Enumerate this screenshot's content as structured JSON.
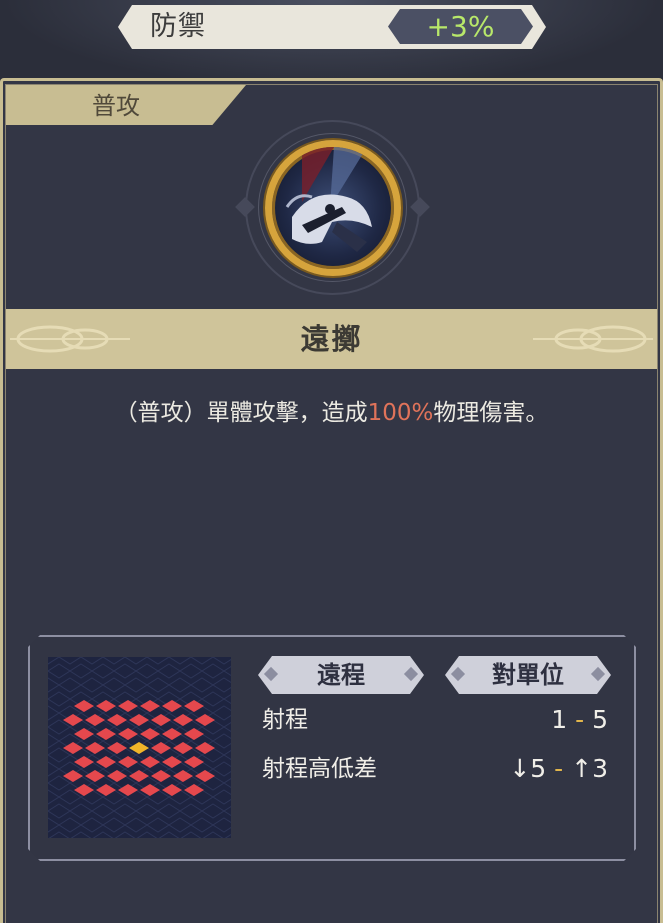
{
  "stat": {
    "label": "防禦",
    "value": "+3%"
  },
  "tab": {
    "label": "普攻"
  },
  "skill": {
    "icon": "thrown-axe-icon",
    "name": "遠擲",
    "description_prefix": "（普攻）單體攻擊，造成",
    "description_highlight": "100%",
    "description_suffix": "物理傷害。"
  },
  "range": {
    "tags": [
      "遠程",
      "對單位"
    ],
    "rows": [
      {
        "label": "射程",
        "min": "1",
        "sep": "-",
        "max": "5"
      },
      {
        "label": "射程高低差",
        "min": "↓5",
        "sep": "-",
        "max": "↑3"
      }
    ],
    "grid_icon": "attack-range-grid"
  },
  "colors": {
    "accent": "#c8bd92",
    "highlight": "#e0735a",
    "stat_value": "#b8e86a",
    "range_cell": "#e5484d",
    "center_cell": "#f0b429"
  }
}
